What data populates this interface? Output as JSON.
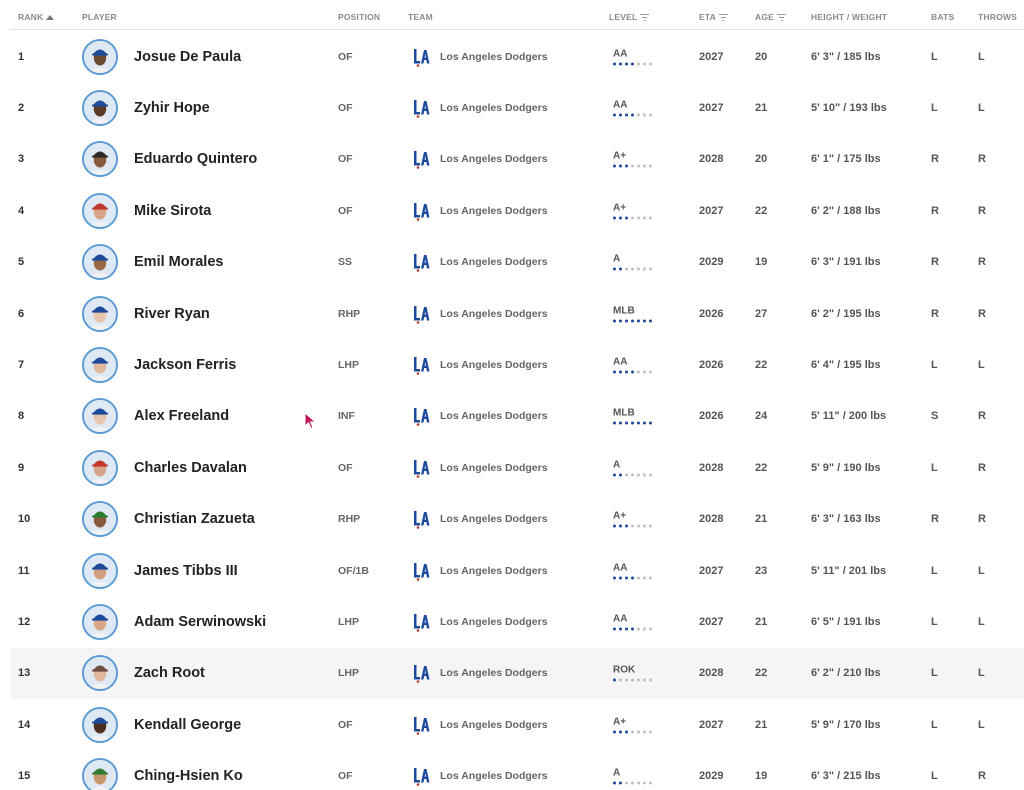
{
  "header": {
    "rank": "RANK",
    "player": "PLAYER",
    "position": "POSITION",
    "team": "TEAM",
    "level": "LEVEL",
    "eta": "ETA",
    "age": "AGE",
    "height_weight": "HEIGHT / WEIGHT",
    "bats": "BATS",
    "throws": "THROWS"
  },
  "colors": {
    "accent_blue": "#1e4a9b",
    "avatar_ring": "#5b9bd5",
    "dot_off": "#c0c0c0"
  },
  "icons": {
    "team_logo": "dodgers-la-logo-icon",
    "sort": "sort-ascending-icon",
    "filter": "filter-icon"
  },
  "players": [
    {
      "rank": "1",
      "name": "Josue De Paula",
      "position": "OF",
      "team": "Los Angeles Dodgers",
      "level": "AA",
      "level_dots": 4,
      "eta": "2027",
      "age": "20",
      "hw": "6' 3\" / 185 lbs",
      "bats": "L",
      "throws": "L",
      "skin": "#6b4a32",
      "cap": "#1e4a9b"
    },
    {
      "rank": "2",
      "name": "Zyhir Hope",
      "position": "OF",
      "team": "Los Angeles Dodgers",
      "level": "AA",
      "level_dots": 4,
      "eta": "2027",
      "age": "21",
      "hw": "5' 10\" / 193 lbs",
      "bats": "L",
      "throws": "L",
      "skin": "#5a3a26",
      "cap": "#1e4a9b"
    },
    {
      "rank": "3",
      "name": "Eduardo Quintero",
      "position": "OF",
      "team": "Los Angeles Dodgers",
      "level": "A+",
      "level_dots": 3,
      "eta": "2028",
      "age": "20",
      "hw": "6' 1\" / 175 lbs",
      "bats": "R",
      "throws": "R",
      "skin": "#8a5a3c",
      "cap": "#2b2b2b"
    },
    {
      "rank": "4",
      "name": "Mike Sirota",
      "position": "OF",
      "team": "Los Angeles Dodgers",
      "level": "A+",
      "level_dots": 3,
      "eta": "2027",
      "age": "22",
      "hw": "6' 2\" / 188 lbs",
      "bats": "R",
      "throws": "R",
      "skin": "#d9a588",
      "cap": "#c0392b"
    },
    {
      "rank": "5",
      "name": "Emil Morales",
      "position": "SS",
      "team": "Los Angeles Dodgers",
      "level": "A",
      "level_dots": 2,
      "eta": "2029",
      "age": "19",
      "hw": "6' 3\" / 191 lbs",
      "bats": "R",
      "throws": "R",
      "skin": "#9a6a48",
      "cap": "#1e4a9b"
    },
    {
      "rank": "6",
      "name": "River Ryan",
      "position": "RHP",
      "team": "Los Angeles Dodgers",
      "level": "MLB",
      "level_dots": 7,
      "eta": "2026",
      "age": "27",
      "hw": "6' 2\" / 195 lbs",
      "bats": "R",
      "throws": "R",
      "skin": "#e8c4ad",
      "cap": "#1e4a9b"
    },
    {
      "rank": "7",
      "name": "Jackson Ferris",
      "position": "LHP",
      "team": "Los Angeles Dodgers",
      "level": "AA",
      "level_dots": 4,
      "eta": "2026",
      "age": "22",
      "hw": "6' 4\" / 195 lbs",
      "bats": "L",
      "throws": "L",
      "skin": "#e0b89c",
      "cap": "#1e4a9b"
    },
    {
      "rank": "8",
      "name": "Alex Freeland",
      "position": "INF",
      "team": "Los Angeles Dodgers",
      "level": "MLB",
      "level_dots": 7,
      "eta": "2026",
      "age": "24",
      "hw": "5' 11\" / 200 lbs",
      "bats": "S",
      "throws": "R",
      "skin": "#e8c4ad",
      "cap": "#1e4a9b"
    },
    {
      "rank": "9",
      "name": "Charles Davalan",
      "position": "OF",
      "team": "Los Angeles Dodgers",
      "level": "A",
      "level_dots": 2,
      "eta": "2028",
      "age": "22",
      "hw": "5' 9\" / 190 lbs",
      "bats": "L",
      "throws": "R",
      "skin": "#d9a588",
      "cap": "#c0392b"
    },
    {
      "rank": "10",
      "name": "Christian Zazueta",
      "position": "RHP",
      "team": "Los Angeles Dodgers",
      "level": "A+",
      "level_dots": 3,
      "eta": "2028",
      "age": "21",
      "hw": "6' 3\" / 163 lbs",
      "bats": "R",
      "throws": "R",
      "skin": "#8a5a3c",
      "cap": "#2e7d32"
    },
    {
      "rank": "11",
      "name": "James Tibbs III",
      "position": "OF/1B",
      "team": "Los Angeles Dodgers",
      "level": "AA",
      "level_dots": 4,
      "eta": "2027",
      "age": "23",
      "hw": "5' 11\" / 201 lbs",
      "bats": "L",
      "throws": "L",
      "skin": "#d2a080",
      "cap": "#1e4a9b"
    },
    {
      "rank": "12",
      "name": "Adam Serwinowski",
      "position": "LHP",
      "team": "Los Angeles Dodgers",
      "level": "AA",
      "level_dots": 4,
      "eta": "2027",
      "age": "21",
      "hw": "6' 5\" / 191 lbs",
      "bats": "L",
      "throws": "L",
      "skin": "#d9a588",
      "cap": "#1e4a9b"
    },
    {
      "rank": "13",
      "name": "Zach Root",
      "position": "LHP",
      "team": "Los Angeles Dodgers",
      "level": "ROK",
      "level_dots": 1,
      "eta": "2028",
      "age": "22",
      "hw": "6' 2\" / 210 lbs",
      "bats": "L",
      "throws": "L",
      "skin": "#e0b89c",
      "cap": "#6d4c41",
      "highlight": true
    },
    {
      "rank": "14",
      "name": "Kendall George",
      "position": "OF",
      "team": "Los Angeles Dodgers",
      "level": "A+",
      "level_dots": 3,
      "eta": "2027",
      "age": "21",
      "hw": "5' 9\" / 170 lbs",
      "bats": "L",
      "throws": "L",
      "skin": "#4a2e1e",
      "cap": "#1e4a9b"
    },
    {
      "rank": "15",
      "name": "Ching-Hsien Ko",
      "position": "OF",
      "team": "Los Angeles Dodgers",
      "level": "A",
      "level_dots": 2,
      "eta": "2029",
      "age": "19",
      "hw": "6' 3\" / 215 lbs",
      "bats": "L",
      "throws": "R",
      "skin": "#c9976e",
      "cap": "#2e7d32"
    }
  ]
}
